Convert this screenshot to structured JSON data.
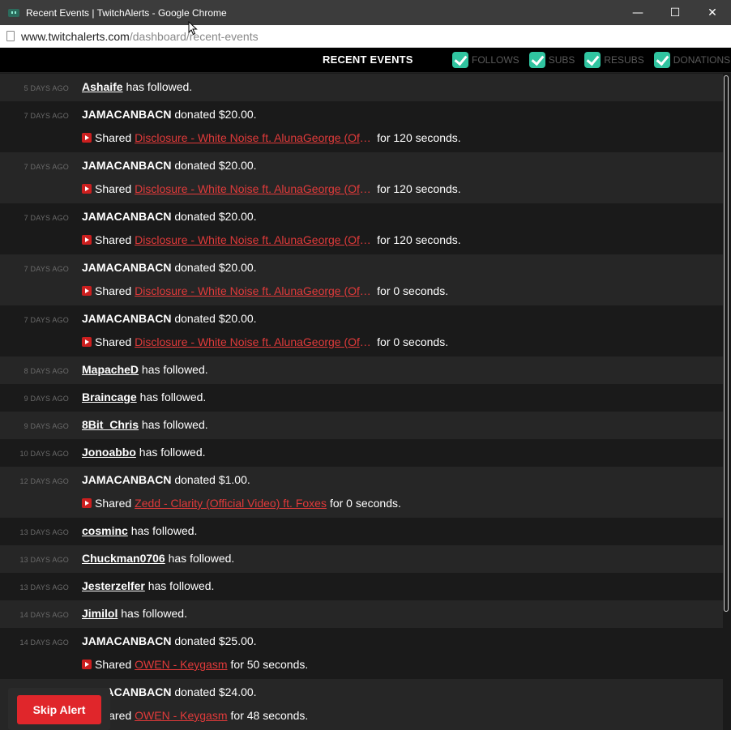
{
  "window": {
    "title": "Recent Events | TwitchAlerts - Google Chrome",
    "minimize": "—",
    "maximize": "☐",
    "close": "✕"
  },
  "address_bar": {
    "domain": "www.twitchalerts.com",
    "path": "/dashboard/recent-events"
  },
  "header": {
    "title": "RECENT EVENTS",
    "filters": [
      {
        "label": "FOLLOWS",
        "checked": true
      },
      {
        "label": "SUBS",
        "checked": true
      },
      {
        "label": "RESUBS",
        "checked": true
      },
      {
        "label": "DONATIONS",
        "checked": true
      }
    ]
  },
  "events": [
    {
      "time": "5 DAYS AGO",
      "user": "Ashaife",
      "action": " has followed."
    },
    {
      "time": "7 DAYS AGO",
      "donor": "JAMACANBACN",
      "amount_text": " donated $20.00.",
      "shared": "Shared",
      "song": "Disclosure - White Noise ft. AlunaGeorge (Official Video)",
      "duration": "for 120 seconds."
    },
    {
      "time": "7 DAYS AGO",
      "donor": "JAMACANBACN",
      "amount_text": " donated $20.00.",
      "shared": "Shared",
      "song": "Disclosure - White Noise ft. AlunaGeorge (Official Video)",
      "duration": "for 120 seconds."
    },
    {
      "time": "7 DAYS AGO",
      "donor": "JAMACANBACN",
      "amount_text": " donated $20.00.",
      "shared": "Shared",
      "song": "Disclosure - White Noise ft. AlunaGeorge (Official Video)",
      "duration": "for 120 seconds."
    },
    {
      "time": "7 DAYS AGO",
      "donor": "JAMACANBACN",
      "amount_text": " donated $20.00.",
      "shared": "Shared",
      "song": "Disclosure - White Noise ft. AlunaGeorge (Official Video)",
      "duration": "for 0 seconds."
    },
    {
      "time": "7 DAYS AGO",
      "donor": "JAMACANBACN",
      "amount_text": " donated $20.00.",
      "shared": "Shared",
      "song": "Disclosure - White Noise ft. AlunaGeorge (Official Video)",
      "duration": "for 0 seconds."
    },
    {
      "time": "8 DAYS AGO",
      "user": "MapacheD",
      "action": " has followed."
    },
    {
      "time": "9 DAYS AGO",
      "user": "Braincage",
      "action": " has followed."
    },
    {
      "time": "9 DAYS AGO",
      "user": "8Bit_Chris",
      "action": " has followed."
    },
    {
      "time": "10 DAYS AGO",
      "user": "Jonoabbo",
      "action": " has followed."
    },
    {
      "time": "12 DAYS AGO",
      "donor": "JAMACANBACN",
      "amount_text": " donated $1.00.",
      "shared": "Shared",
      "song": "Zedd - Clarity (Official Video) ft. Foxes",
      "duration": "for 0 seconds."
    },
    {
      "time": "13 DAYS AGO",
      "user": "cosminc",
      "action": " has followed."
    },
    {
      "time": "13 DAYS AGO",
      "user": "Chuckman0706",
      "action": " has followed."
    },
    {
      "time": "13 DAYS AGO",
      "user": "Jesterzelfer",
      "action": " has followed."
    },
    {
      "time": "14 DAYS AGO",
      "user": "Jimilol",
      "action": " has followed."
    },
    {
      "time": "14 DAYS AGO",
      "donor": "JAMACANBACN",
      "amount_text": " donated $25.00.",
      "shared": "Shared",
      "song": "OWEN - Keygasm",
      "duration": "for 50 seconds."
    },
    {
      "time": "",
      "donor": "JAMACANBACN",
      "amount_text": " donated $24.00.",
      "shared": "Shared",
      "song": "OWEN - Keygasm",
      "duration": "for 48 seconds."
    }
  ],
  "skip_alert": "Skip Alert"
}
